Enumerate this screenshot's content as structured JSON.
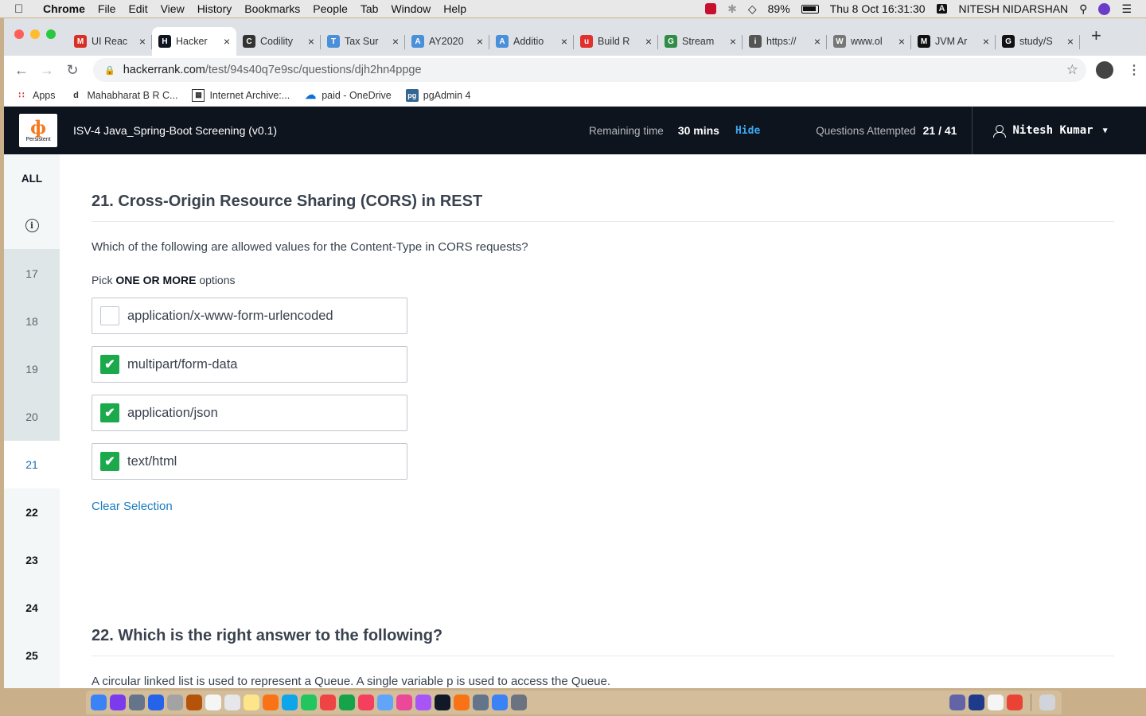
{
  "menubar": {
    "app_name": "Chrome",
    "menus": [
      "File",
      "Edit",
      "View",
      "History",
      "Bookmarks",
      "People",
      "Tab",
      "Window",
      "Help"
    ],
    "battery": "89%",
    "datetime": "Thu 8 Oct  16:31:30",
    "input_source": "A",
    "user": "NITESH NIDARSHAN"
  },
  "tabs": [
    {
      "title": "UI Reac",
      "icon": "gmail-icon",
      "color": "#d93025",
      "glyph": "M"
    },
    {
      "title": "Hacker",
      "icon": "hackerrank-icon",
      "color": "#0e141e",
      "glyph": "H"
    },
    {
      "title": "Codility",
      "icon": "codility-icon",
      "color": "#333333",
      "glyph": "C"
    },
    {
      "title": "Tax Sur",
      "icon": "tax-icon",
      "color": "#4a90d9",
      "glyph": "T"
    },
    {
      "title": "AY2020",
      "icon": "tax-icon",
      "color": "#4a90d9",
      "glyph": "A"
    },
    {
      "title": "Additio",
      "icon": "tax-icon",
      "color": "#4a90d9",
      "glyph": "A"
    },
    {
      "title": "Build R",
      "icon": "udemy-icon",
      "color": "#e0312e",
      "glyph": "u"
    },
    {
      "title": "Stream",
      "icon": "gfg-icon",
      "color": "#2f8d46",
      "glyph": "G"
    },
    {
      "title": "https://",
      "icon": "page-icon",
      "color": "#555555",
      "glyph": "i"
    },
    {
      "title": "www.ol",
      "icon": "wordpress-icon",
      "color": "#777777",
      "glyph": "W"
    },
    {
      "title": "JVM Ar",
      "icon": "medium-icon",
      "color": "#111111",
      "glyph": "M"
    },
    {
      "title": "study/S",
      "icon": "github-icon",
      "color": "#111111",
      "glyph": "G"
    }
  ],
  "active_tab_index": 1,
  "address": {
    "host": "hackerrank.com",
    "path": "/test/94s40q7e9sc/questions/djh2hn4ppge"
  },
  "bookmarks": [
    {
      "label": "Apps",
      "icon": "apps-grid-icon"
    },
    {
      "label": "Mahabharat B R C...",
      "icon": "d-icon"
    },
    {
      "label": "Internet Archive:...",
      "icon": "archive-icon"
    },
    {
      "label": "paid - OneDrive",
      "icon": "onedrive-icon"
    },
    {
      "label": "pgAdmin 4",
      "icon": "pgadmin-icon"
    }
  ],
  "header": {
    "logo_text": "Persistent",
    "test_title": "ISV-4 Java_Spring-Boot Screening (v0.1)",
    "remaining_label": "Remaining time",
    "remaining_value": "30 mins",
    "hide_label": "Hide",
    "attempted_label": "Questions Attempted",
    "attempted_value": "21 / 41",
    "user_name": "Nitesh Kumar"
  },
  "sidebar": {
    "all_label": "ALL",
    "items": [
      {
        "number": "17",
        "state": "answered"
      },
      {
        "number": "18",
        "state": "answered"
      },
      {
        "number": "19",
        "state": "answered"
      },
      {
        "number": "20",
        "state": "answered"
      },
      {
        "number": "21",
        "state": "current"
      },
      {
        "number": "22",
        "state": "unanswered"
      },
      {
        "number": "23",
        "state": "unanswered"
      },
      {
        "number": "24",
        "state": "unanswered"
      },
      {
        "number": "25",
        "state": "unanswered"
      }
    ]
  },
  "question": {
    "title": "21. Cross-Origin Resource Sharing (CORS) in REST",
    "text": "Which of the following are allowed values for the Content-Type in CORS requests?",
    "pick_prefix": "Pick ",
    "pick_bold": "ONE OR MORE",
    "pick_suffix": " options",
    "options": [
      {
        "label": "application/x-www-form-urlencoded",
        "checked": false
      },
      {
        "label": "multipart/form-data",
        "checked": true
      },
      {
        "label": "application/json",
        "checked": true
      },
      {
        "label": "text/html",
        "checked": true
      }
    ],
    "clear_label": "Clear Selection"
  },
  "next_question": {
    "title": "22. Which is the right answer to the following?",
    "text": "A circular linked list is used to represent a Queue.  A single variable p is used to access the Queue."
  },
  "colors": {
    "header_bg": "#0e141e",
    "checked_green": "#1ba94c",
    "link_blue": "#1a7bc1",
    "hide_blue": "#39a8f0",
    "logo_orange": "#f47a20"
  }
}
